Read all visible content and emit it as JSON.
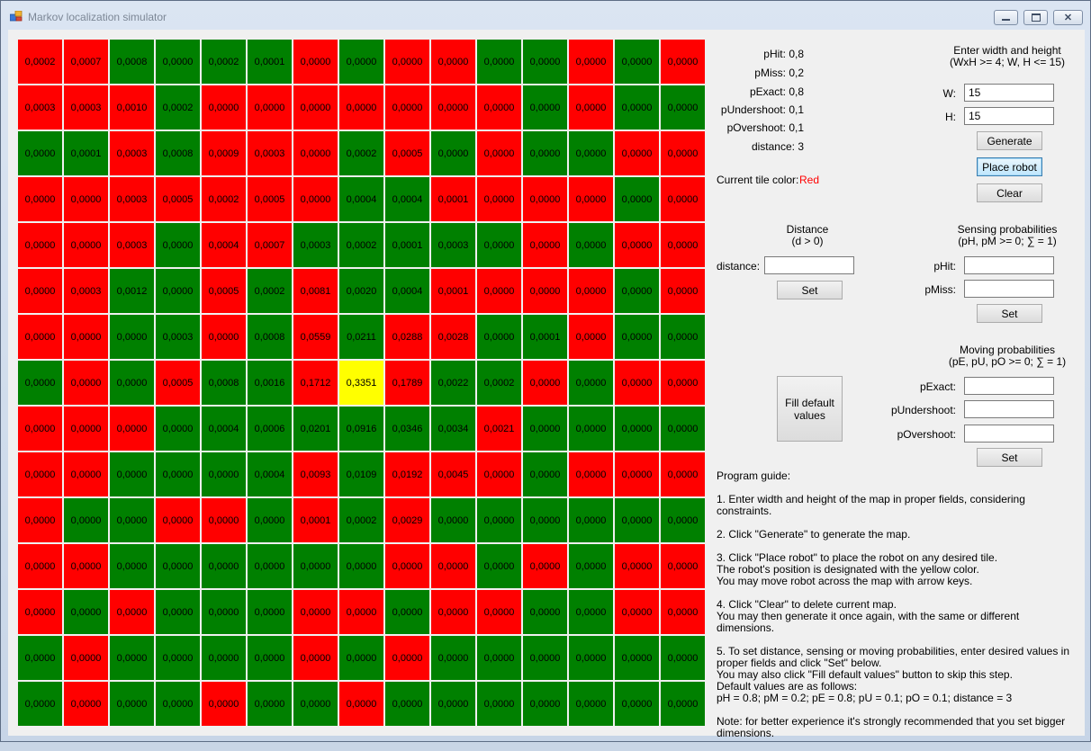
{
  "window": {
    "title": "Markov localization simulator"
  },
  "stats": [
    {
      "label": "pHit: ",
      "value": "0,8"
    },
    {
      "label": "pMiss: ",
      "value": "0,2"
    },
    {
      "label": "pExact: ",
      "value": "0,8"
    },
    {
      "label": "pUndershoot: ",
      "value": "0,1"
    },
    {
      "label": "pOvershoot: ",
      "value": "0,1"
    },
    {
      "label": "distance: ",
      "value": "3"
    }
  ],
  "current_tile": {
    "label": "Current tile color:",
    "value": "Red"
  },
  "dims": {
    "title": "Enter width and height\n(WxH >= 4; W, H <= 15)",
    "w_label": "W:",
    "w_value": "15",
    "h_label": "H:",
    "h_value": "15",
    "generate": "Generate",
    "place_robot": "Place robot",
    "clear": "Clear"
  },
  "distance": {
    "title": "Distance\n(d > 0)",
    "label": "distance:",
    "value": "",
    "set": "Set"
  },
  "sensing": {
    "title": "Sensing probabilities\n(pH, pM >= 0; ∑ = 1)",
    "phit_label": "pHit:",
    "pmiss_label": "pMiss:",
    "phit_value": "",
    "pmiss_value": "",
    "set": "Set"
  },
  "moving": {
    "title": "Moving probabilities\n(pE, pU, pO >= 0; ∑ = 1)",
    "pexact_label": "pExact:",
    "punder_label": "pUndershoot:",
    "pover_label": "pOvershoot:",
    "pexact_value": "",
    "punder_value": "",
    "pover_value": "",
    "set": "Set"
  },
  "fill_default": "Fill default\nvalues",
  "guide": [
    "Program guide:",
    "1. Enter width and height of the map in proper fields, considering constraints.",
    "2. Click \"Generate\" to generate the map.",
    "3. Click \"Place robot\" to place the robot on any desired tile.\nThe robot's position is designated with the yellow color.\nYou may move robot across the map with arrow keys.",
    "4. Click \"Clear\" to delete current map.\nYou may then generate it once again, with the same or different dimensions.",
    "5. To set distance, sensing or moving probabilities, enter desired values in proper fields and click \"Set\" below.\nYou may also click \"Fill default values\" button to skip this step.\nDefault values are as follows:\npH = 0.8; pM = 0.2; pE = 0.8; pU = 0.1; pO = 0.1; distance = 3",
    "Note: for better experience it's strongly recommended that you set bigger dimensions."
  ],
  "colors": {
    "red": "#ff0000",
    "green": "#008000",
    "yellow": "#ffff00",
    "tile_color_text": "#ff0000"
  },
  "grid": {
    "colors": [
      "RRGGGGRGRRGGRGR",
      "RRRGRRRRRRRGRGG",
      "GGRGRRRGRGRGGRR",
      "RRRRRRRGGRRRRGR",
      "RRRGRRGGGGGRGRR",
      "RRGGRGRGGRRRRGR",
      "RRGGRGRGRRGGRGG",
      "GRGRGGRYRGGRGRR",
      "RRRGGGGGGGRGGGG",
      "RRGGGGRGRRRGRRR",
      "RGGRRGRGRGGGGGG",
      "RRGGGGGGRRGRGRR",
      "RGRGGGRRGRRGGRR",
      "GRGGGGRGRGGGGGG",
      "GRGGRGGRGGGGGGG"
    ],
    "values": [
      [
        "0,0002",
        "0,0007",
        "0,0008",
        "0,0000",
        "0,0002",
        "0,0001",
        "0,0000",
        "0,0000",
        "0,0000",
        "0,0000",
        "0,0000",
        "0,0000",
        "0,0000",
        "0,0000",
        "0,0000"
      ],
      [
        "0,0003",
        "0,0003",
        "0,0010",
        "0,0002",
        "0,0000",
        "0,0000",
        "0,0000",
        "0,0000",
        "0,0000",
        "0,0000",
        "0,0000",
        "0,0000",
        "0,0000",
        "0,0000",
        "0,0000"
      ],
      [
        "0,0000",
        "0,0001",
        "0,0003",
        "0,0008",
        "0,0009",
        "0,0003",
        "0,0000",
        "0,0002",
        "0,0005",
        "0,0000",
        "0,0000",
        "0,0000",
        "0,0000",
        "0,0000",
        "0,0000"
      ],
      [
        "0,0000",
        "0,0000",
        "0,0003",
        "0,0005",
        "0,0002",
        "0,0005",
        "0,0000",
        "0,0004",
        "0,0004",
        "0,0001",
        "0,0000",
        "0,0000",
        "0,0000",
        "0,0000",
        "0,0000"
      ],
      [
        "0,0000",
        "0,0000",
        "0,0003",
        "0,0000",
        "0,0004",
        "0,0007",
        "0,0003",
        "0,0002",
        "0,0001",
        "0,0003",
        "0,0000",
        "0,0000",
        "0,0000",
        "0,0000",
        "0,0000"
      ],
      [
        "0,0000",
        "0,0003",
        "0,0012",
        "0,0000",
        "0,0005",
        "0,0002",
        "0,0081",
        "0,0020",
        "0,0004",
        "0,0001",
        "0,0000",
        "0,0000",
        "0,0000",
        "0,0000",
        "0,0000"
      ],
      [
        "0,0000",
        "0,0000",
        "0,0000",
        "0,0003",
        "0,0000",
        "0,0008",
        "0,0559",
        "0,0211",
        "0,0288",
        "0,0028",
        "0,0000",
        "0,0001",
        "0,0000",
        "0,0000",
        "0,0000"
      ],
      [
        "0,0000",
        "0,0000",
        "0,0000",
        "0,0005",
        "0,0008",
        "0,0016",
        "0,1712",
        "0,3351",
        "0,1789",
        "0,0022",
        "0,0002",
        "0,0000",
        "0,0000",
        "0,0000",
        "0,0000"
      ],
      [
        "0,0000",
        "0,0000",
        "0,0000",
        "0,0000",
        "0,0004",
        "0,0006",
        "0,0201",
        "0,0916",
        "0,0346",
        "0,0034",
        "0,0021",
        "0,0000",
        "0,0000",
        "0,0000",
        "0,0000"
      ],
      [
        "0,0000",
        "0,0000",
        "0,0000",
        "0,0000",
        "0,0000",
        "0,0004",
        "0,0093",
        "0,0109",
        "0,0192",
        "0,0045",
        "0,0000",
        "0,0000",
        "0,0000",
        "0,0000",
        "0,0000"
      ],
      [
        "0,0000",
        "0,0000",
        "0,0000",
        "0,0000",
        "0,0000",
        "0,0000",
        "0,0001",
        "0,0002",
        "0,0029",
        "0,0000",
        "0,0000",
        "0,0000",
        "0,0000",
        "0,0000",
        "0,0000"
      ],
      [
        "0,0000",
        "0,0000",
        "0,0000",
        "0,0000",
        "0,0000",
        "0,0000",
        "0,0000",
        "0,0000",
        "0,0000",
        "0,0000",
        "0,0000",
        "0,0000",
        "0,0000",
        "0,0000",
        "0,0000"
      ],
      [
        "0,0000",
        "0,0000",
        "0,0000",
        "0,0000",
        "0,0000",
        "0,0000",
        "0,0000",
        "0,0000",
        "0,0000",
        "0,0000",
        "0,0000",
        "0,0000",
        "0,0000",
        "0,0000",
        "0,0000"
      ],
      [
        "0,0000",
        "0,0000",
        "0,0000",
        "0,0000",
        "0,0000",
        "0,0000",
        "0,0000",
        "0,0000",
        "0,0000",
        "0,0000",
        "0,0000",
        "0,0000",
        "0,0000",
        "0,0000",
        "0,0000"
      ],
      [
        "0,0000",
        "0,0000",
        "0,0000",
        "0,0000",
        "0,0000",
        "0,0000",
        "0,0000",
        "0,0000",
        "0,0000",
        "0,0000",
        "0,0000",
        "0,0000",
        "0,0000",
        "0,0000",
        "0,0000"
      ]
    ]
  }
}
